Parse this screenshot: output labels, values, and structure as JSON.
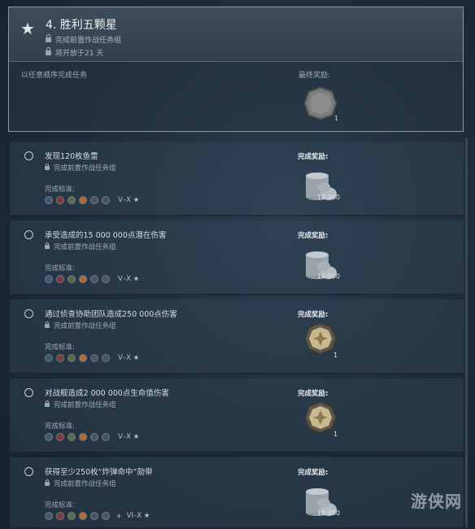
{
  "header": {
    "title": "4. 胜利五颗星",
    "lock1": "完成前置作战任务组",
    "lock2": "将开放于21 天",
    "description": "以任意顺序完成任务",
    "final_reward_label": "最终奖励:",
    "final_reward_count": "1"
  },
  "tasks": [
    {
      "title": "发现120枚鱼雷",
      "lock": "完成前置作战任务组",
      "criteria_label": "完成标准:",
      "tier": "V–X ★",
      "reward_label": "完成奖励:",
      "reward_amount": "10 000",
      "reward_type": "credits",
      "reward_count": ""
    },
    {
      "title": "承受造成的15 000 000点潜在伤害",
      "lock": "完成前置作战任务组",
      "criteria_label": "完成标准:",
      "tier": "V–X ★",
      "reward_label": "完成奖励:",
      "reward_amount": "10 000",
      "reward_type": "credits",
      "reward_count": ""
    },
    {
      "title": "通过侦查协助团队造成250 000点伤害",
      "lock": "完成前置作战任务组",
      "criteria_label": "完成标准:",
      "tier": "V–X ★",
      "reward_label": "完成奖励:",
      "reward_amount": "",
      "reward_type": "coin",
      "reward_count": "1"
    },
    {
      "title": "对战舰造成2 000 000点生命值伤害",
      "lock": "完成前置作战任务组",
      "criteria_label": "完成标准:",
      "tier": "V–X ★",
      "reward_label": "完成奖励:",
      "reward_amount": "",
      "reward_type": "coin",
      "reward_count": "1"
    },
    {
      "title": "获得至少250枚“炸弹命中”勋带",
      "lock": "完成前置作战任务组",
      "criteria_label": "完成标准:",
      "tier": "VI–X ★",
      "reward_label": "完成奖励:",
      "reward_amount": "10 000",
      "reward_type": "credits",
      "reward_count": ""
    }
  ],
  "watermark": "游侠网",
  "colors": {
    "accent": "#e4e8ec",
    "panel": "#344658",
    "border": "#8b97a3"
  }
}
